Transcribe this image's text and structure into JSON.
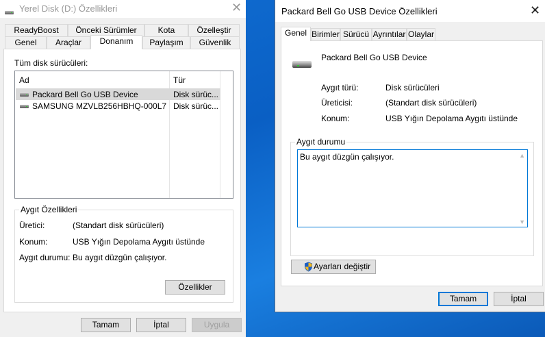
{
  "left_window": {
    "title": "Yerel Disk (D:) Özellikleri",
    "tabs_row1": [
      "ReadyBoost",
      "Önceki Sürümler",
      "Kota",
      "Özelleştir"
    ],
    "tabs_row2": [
      "Genel",
      "Araçlar",
      "Donanım",
      "Paylaşım",
      "Güvenlik"
    ],
    "selected_tab": "Donanım",
    "list_label": "Tüm disk sürücüleri:",
    "columns": [
      "Ad",
      "Tür"
    ],
    "rows": [
      {
        "name": "Packard Bell Go USB Device",
        "type": "Disk sürüc...",
        "selected": true
      },
      {
        "name": "SAMSUNG MZVLB256HBHQ-000L7",
        "type": "Disk sürüc..."
      }
    ],
    "props_group": "Aygıt Özellikleri",
    "props": [
      {
        "label": "Üretici:",
        "value": "(Standart disk sürücüleri)"
      },
      {
        "label": "Konum:",
        "value": "USB Yığın Depolama Aygıtı üstünde"
      },
      {
        "label": "Aygıt durumu:",
        "value": "Bu aygıt düzgün çalışıyor."
      }
    ],
    "properties_button": "Özellikler",
    "ok": "Tamam",
    "cancel": "İptal",
    "apply": "Uygula"
  },
  "right_window": {
    "title": "Packard Bell Go USB Device Özellikleri",
    "tabs": [
      "Genel",
      "Birimler",
      "Sürücü",
      "Ayrıntılar",
      "Olaylar"
    ],
    "selected_tab": "Genel",
    "device_name": "Packard Bell Go USB Device",
    "info": [
      {
        "label": "Aygıt türü:",
        "value": "Disk sürücüleri"
      },
      {
        "label": "Üreticisi:",
        "value": "(Standart disk sürücüleri)"
      },
      {
        "label": "Konum:",
        "value": "USB Yığın Depolama Aygıtı üstünde"
      }
    ],
    "status_group": "Aygıt durumu",
    "status_text": "Bu aygıt düzgün çalışıyor.",
    "change_settings": "Ayarları değiştir",
    "ok": "Tamam",
    "cancel": "İptal"
  },
  "colors": {
    "accent": "#0078d7",
    "desktop": "#0a64c8"
  }
}
